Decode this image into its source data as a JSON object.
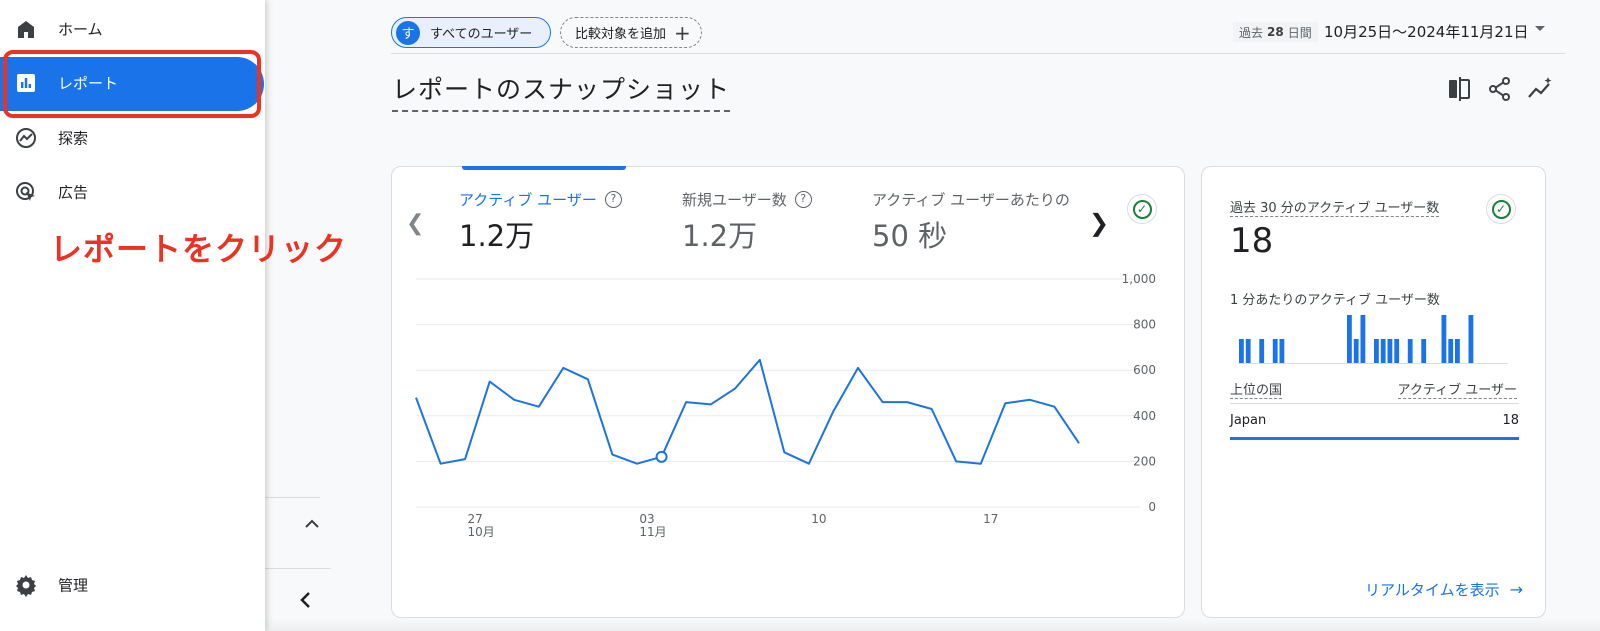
{
  "nav": {
    "items": [
      {
        "label": "ホーム",
        "icon": "home-icon"
      },
      {
        "label": "レポート",
        "icon": "bar-chart-icon"
      },
      {
        "label": "探索",
        "icon": "explore-icon"
      },
      {
        "label": "広告",
        "icon": "ads-icon"
      }
    ],
    "admin": {
      "label": "管理",
      "icon": "gear-icon"
    },
    "active_color": "#1a73e8"
  },
  "annotation": {
    "text": "レポートをクリック",
    "color": "#ea3323"
  },
  "header": {
    "segment_avatar": "す",
    "segment_label": "すべてのユーザー",
    "compare_label": "比較対象を追加",
    "date_prefix": "過去",
    "date_days": "28",
    "date_suffix": "日間",
    "date_range": "10月25日〜2024年11月21日"
  },
  "page_title": "レポートのスナップショット",
  "metrics": [
    {
      "label": "アクティブ ユーザー",
      "value": "1.2万"
    },
    {
      "label": "新規ユーザー数",
      "value": "1.2万"
    },
    {
      "label": "アクティブ ユーザーあたりの",
      "value": "50 秒"
    }
  ],
  "chart_data": {
    "type": "line",
    "series": [
      {
        "values": [
          480,
          190,
          210,
          550,
          470,
          440,
          610,
          560,
          230,
          190,
          220,
          460,
          450,
          520,
          645,
          240,
          190,
          420,
          610,
          460,
          460,
          430,
          200,
          190,
          455,
          470,
          440,
          280
        ]
      }
    ],
    "y_ticks": [
      "1,000",
      "800",
      "600",
      "400",
      "200",
      "0"
    ],
    "ylim": [
      0,
      1000
    ],
    "x_ticks": [
      {
        "index": 2,
        "day": "27",
        "month": "10月"
      },
      {
        "index": 9,
        "day": "03",
        "month": "11月"
      },
      {
        "index": 16,
        "day": "10",
        "month": ""
      },
      {
        "index": 23,
        "day": "17",
        "month": ""
      }
    ],
    "highlight_index": 10,
    "color": "#1a73e8"
  },
  "realtime": {
    "title": "過去 30 分のアクティブ ユーザー数",
    "value": "18",
    "sub_title": "1 分あたりのアクティブ ユーザー数",
    "bars": [
      1,
      1,
      0,
      1,
      0,
      1,
      1,
      0,
      0,
      0,
      0,
      0,
      0,
      0,
      0,
      0,
      2,
      1,
      2,
      0,
      1,
      1,
      1,
      1,
      0,
      1,
      0,
      1,
      0,
      0,
      2,
      1,
      1,
      0,
      2,
      0,
      0,
      0,
      0,
      0
    ],
    "country_header": "上位の国",
    "users_header": "アクティブ ユーザー",
    "rows": [
      {
        "country": "Japan",
        "count": "18"
      }
    ],
    "link": "リアルタイムを表示"
  }
}
